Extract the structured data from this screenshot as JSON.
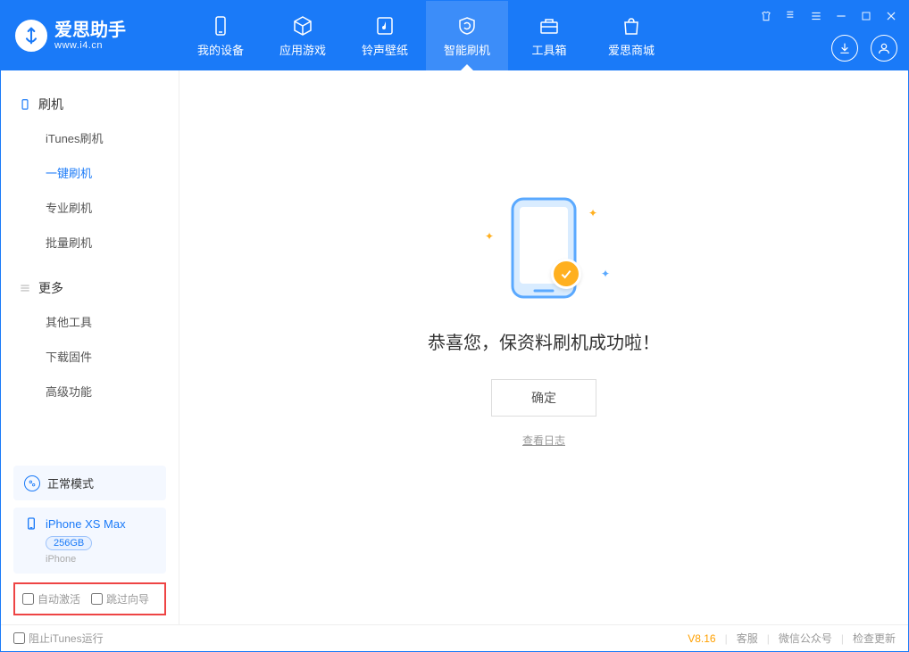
{
  "app": {
    "title": "爱思助手",
    "subtitle": "www.i4.cn"
  },
  "nav": {
    "items": [
      {
        "label": "我的设备"
      },
      {
        "label": "应用游戏"
      },
      {
        "label": "铃声壁纸"
      },
      {
        "label": "智能刷机"
      },
      {
        "label": "工具箱"
      },
      {
        "label": "爱思商城"
      }
    ]
  },
  "sidebar": {
    "group1": {
      "title": "刷机",
      "items": [
        {
          "label": "iTunes刷机"
        },
        {
          "label": "一键刷机"
        },
        {
          "label": "专业刷机"
        },
        {
          "label": "批量刷机"
        }
      ]
    },
    "group2": {
      "title": "更多",
      "items": [
        {
          "label": "其他工具"
        },
        {
          "label": "下载固件"
        },
        {
          "label": "高级功能"
        }
      ]
    },
    "mode_label": "正常模式",
    "device": {
      "name": "iPhone XS Max",
      "capacity": "256GB",
      "type": "iPhone"
    },
    "options": {
      "auto_activate": "自动激活",
      "skip_guide": "跳过向导"
    }
  },
  "main": {
    "success_text": "恭喜您，保资料刷机成功啦！",
    "confirm_label": "确定",
    "view_log_label": "查看日志"
  },
  "footer": {
    "block_itunes": "阻止iTunes运行",
    "version": "V8.16",
    "links": {
      "service": "客服",
      "wechat": "微信公众号",
      "update": "检查更新"
    }
  }
}
